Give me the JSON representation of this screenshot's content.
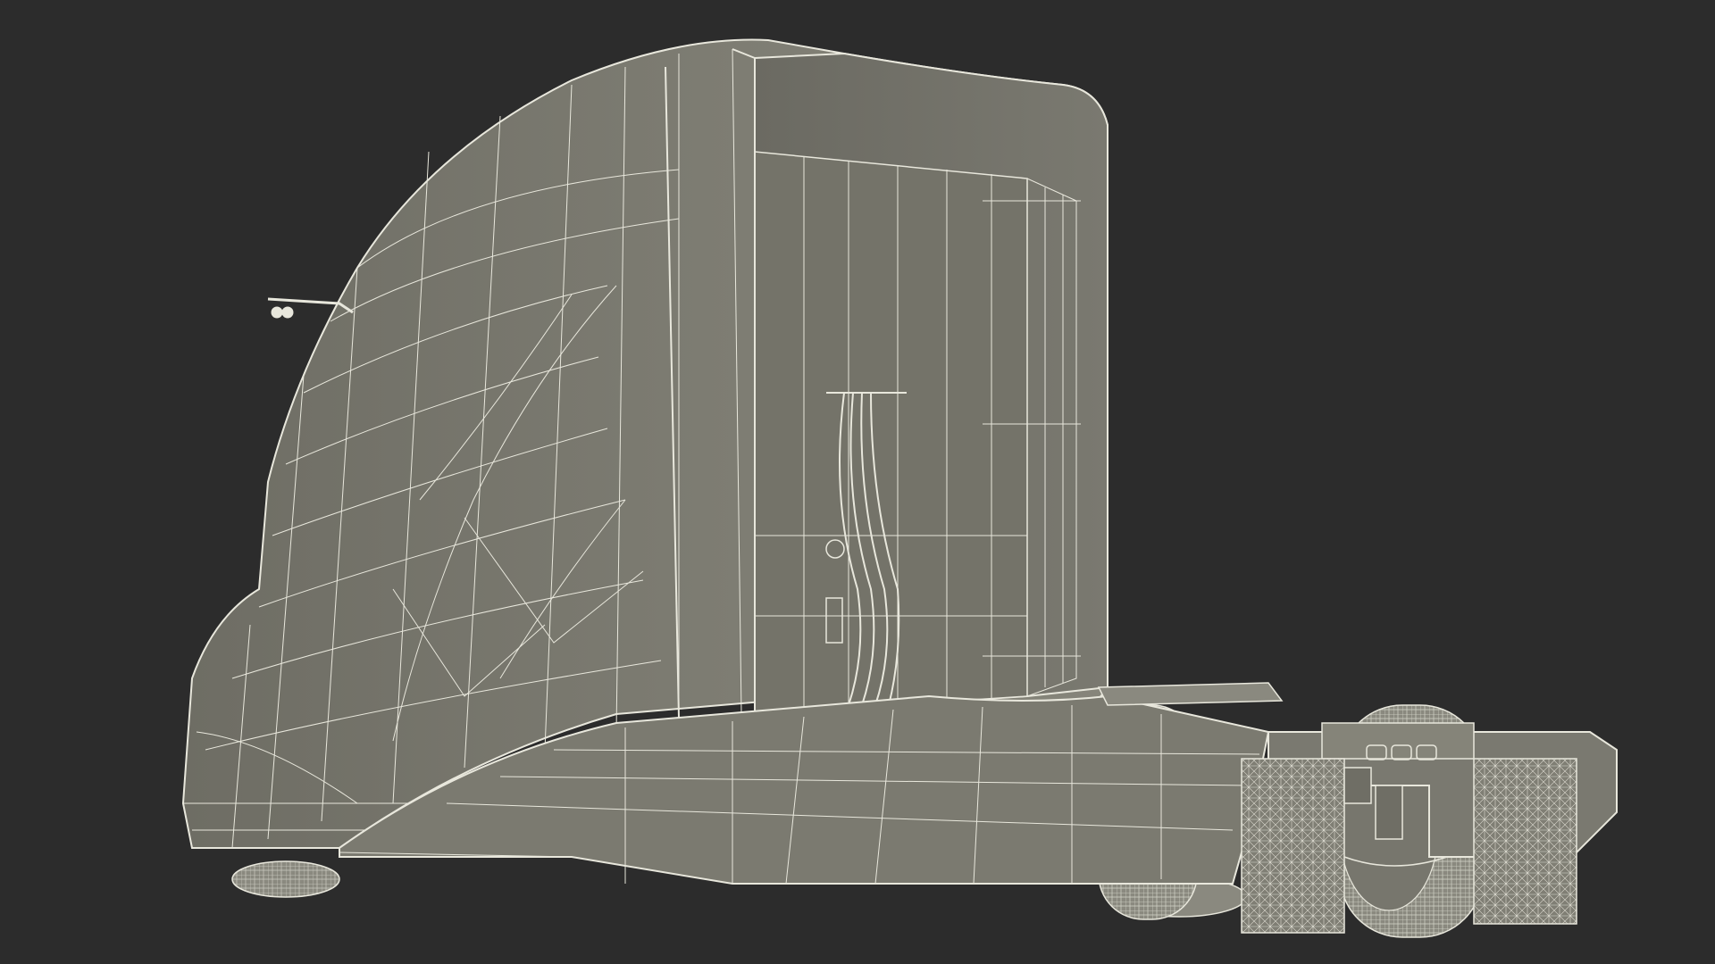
{
  "scene": {
    "subject": "semi-truck-tractor-wireframe",
    "background_color": "#2c2c2c",
    "surface_color": "#7e7d73",
    "surface_shade_color": "#6e6d64",
    "interior_color": "#76756c",
    "wire_color": "#e8e7dc",
    "tire_color": "#8a897f"
  }
}
